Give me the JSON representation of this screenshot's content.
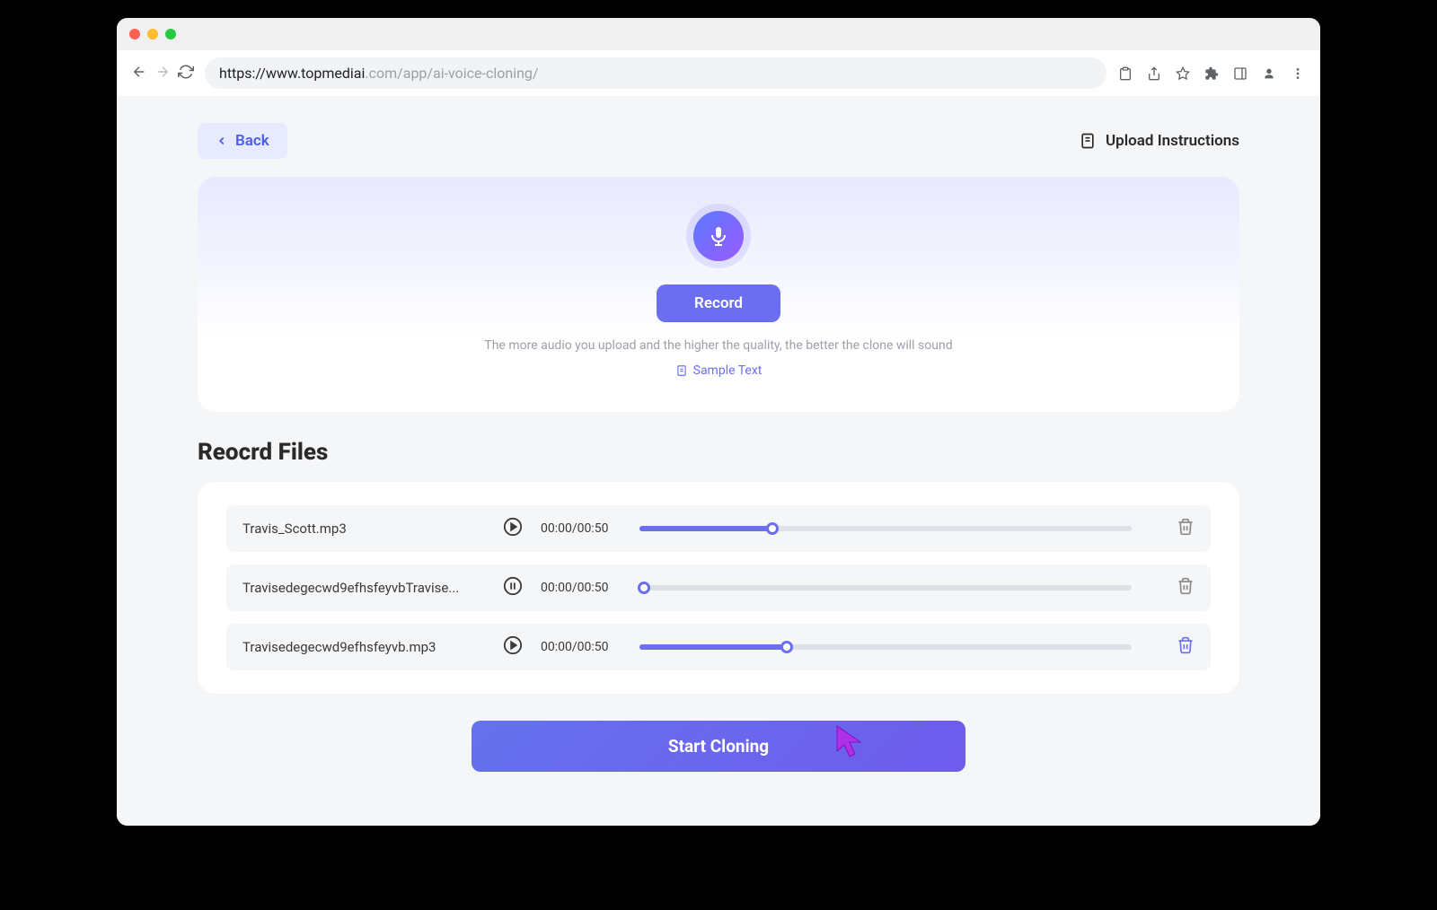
{
  "browser": {
    "url_prefix": "https://www.topmediai",
    "url_suffix": ".com/app/ai-voice-cloning/"
  },
  "header": {
    "back_label": "Back",
    "upload_instructions_label": "Upload Instructions"
  },
  "record_panel": {
    "record_button": "Record",
    "hint": "The more audio you upload and the higher the quality, the better the clone will sound",
    "sample_text_label": "Sample Text"
  },
  "files_section": {
    "title": "Reocrd Files"
  },
  "files": [
    {
      "name": "Travis_Scott.mp3",
      "time": "00:00/00:50",
      "progress_percent": 27,
      "state": "play",
      "delete_highlight": false
    },
    {
      "name": "Travisedegecwd9efhsfeyvbTravise...",
      "time": "00:00/00:50",
      "progress_percent": 1,
      "state": "pause",
      "delete_highlight": false
    },
    {
      "name": "Travisedegecwd9efhsfeyvb.mp3",
      "time": "00:00/00:50",
      "progress_percent": 30,
      "state": "play",
      "delete_highlight": true
    }
  ],
  "actions": {
    "start_cloning": "Start Cloning"
  }
}
